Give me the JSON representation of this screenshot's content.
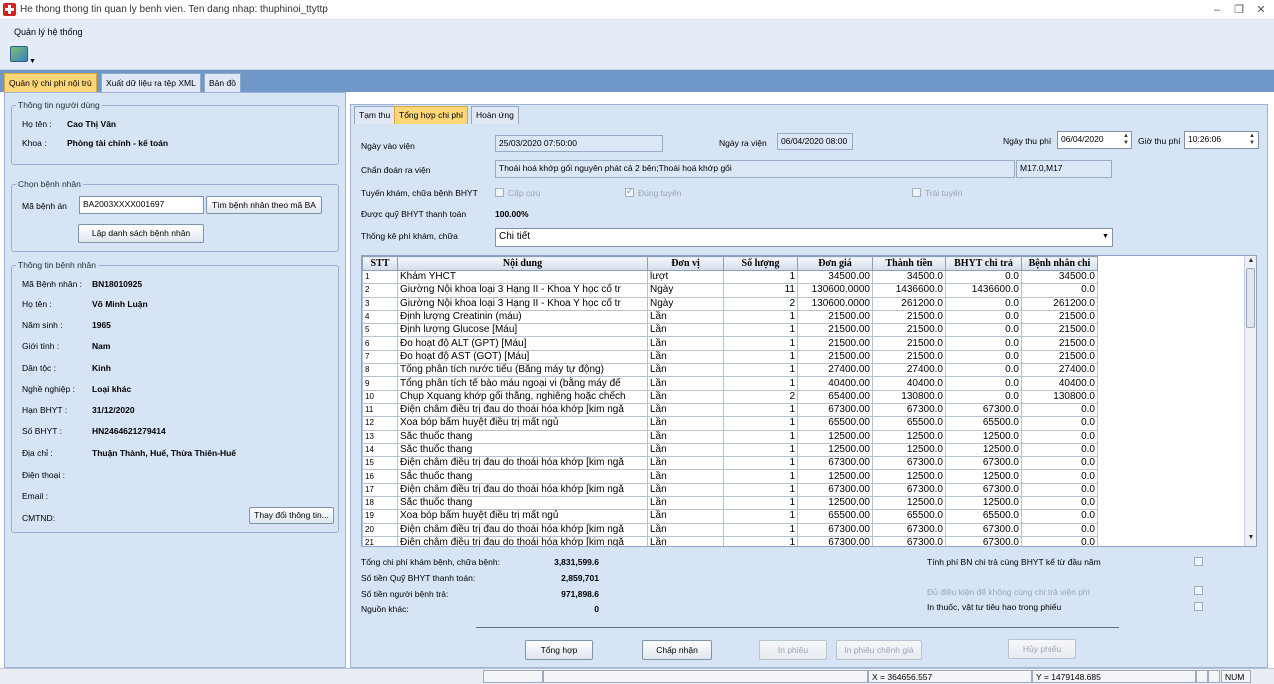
{
  "window": {
    "title": "He thong thong tin quan ly benh vien. Ten dang nhap: thuphinoi_ttyttp",
    "minimize": "–",
    "restore": "❐",
    "close": "✕"
  },
  "menu": {
    "system": "Quản lý hệ thống"
  },
  "toolbar": {
    "arrow": "▼"
  },
  "main_tabs": [
    "Quản lý chi phí nội trú",
    "Xuất dữ liệu ra tệp XML",
    "Bản đồ"
  ],
  "user_info": {
    "legend": "Thông tin người dùng",
    "name_label": "Họ tên :",
    "name": "Cao Thị Vân",
    "dept_label": "Khoa :",
    "dept": "Phòng tài chính - kế toán"
  },
  "select_patient": {
    "legend": "Chọn bệnh nhân",
    "record_label": "Mã bệnh án",
    "record_value": "BA2003XXXX001697",
    "search_button": "Tìm bệnh nhân theo mã BA",
    "list_button": "Lập danh sách bệnh nhân"
  },
  "patient_info": {
    "legend": "Thông tin bệnh nhân",
    "fields": [
      {
        "label": "Mã Bệnh nhân :",
        "value": "BN18010925"
      },
      {
        "label": "Họ tên :",
        "value": "Võ Minh Luận"
      },
      {
        "label": "Năm sinh :",
        "value": "1965"
      },
      {
        "label": "Giới tính :",
        "value": "Nam"
      },
      {
        "label": "Dân tộc :",
        "value": "Kinh"
      },
      {
        "label": "Nghề nghiệp :",
        "value": "Loại khác"
      },
      {
        "label": "Hạn BHYT :",
        "value": "31/12/2020"
      },
      {
        "label": "Số BHYT :",
        "value": "HN2464621279414"
      },
      {
        "label": "Địa chỉ :",
        "value": "Thuận Thành, Huế, Thừa Thiên-Huế"
      },
      {
        "label": "Điện thoại :",
        "value": ""
      },
      {
        "label": "Email :",
        "value": ""
      },
      {
        "label": "CMTND:",
        "value": ""
      }
    ],
    "change_button": "Thay đổi thông tin..."
  },
  "sub_tabs": [
    "Tạm thu",
    "Tổng hợp chi phí",
    "Hoàn ứng"
  ],
  "admission": {
    "admit_label": "Ngày vào viện",
    "admit_value": "25/03/2020 07:50:00",
    "discharge_label": "Ngày ra viện",
    "discharge_value": "06/04/2020 08:00",
    "fee_date_label": "Ngày thu phí",
    "fee_date_value": "06/04/2020",
    "fee_time_label": "Giờ thu phí",
    "fee_time_value": "10:26:06",
    "diagnosis_label": "Chẩn đoán ra viện",
    "diagnosis_value": "Thoái hoá khớp gối nguyên phát cả 2 bên;Thoái hoá khớp gối",
    "icd_value": "M17.0,M17",
    "route_label": "Tuyến khám, chữa bệnh BHYT",
    "emergency_label": "Cấp cứu",
    "correct_route_label": "Đúng tuyến",
    "wrong_route_label": "Trái tuyến",
    "fund_label": "Được quỹ BHYT thanh toán",
    "fund_value": "100.00%",
    "stats_label": "Thống kê phí khám, chữa",
    "stats_value": "Chi tiết"
  },
  "grid": {
    "columns": [
      "STT",
      "Nội dung",
      "Đơn vị",
      "Số lượng",
      "Đơn giá",
      "Thành tiền",
      "BHYT chi trả",
      "Bệnh nhân chi"
    ],
    "rows": [
      [
        "1",
        "Khám YHCT",
        "lượt",
        "1",
        "34500.00",
        "34500.0",
        "0.0",
        "34500.0"
      ],
      [
        "2",
        "Giường Nội khoa loại 3 Hạng II - Khoa Y học cổ tr",
        "Ngày",
        "11",
        "130600.0000",
        "1436600.0",
        "1436600.0",
        "0.0"
      ],
      [
        "3",
        "Giường Nội khoa loại 3 Hạng II - Khoa Y học cổ tr",
        "Ngày",
        "2",
        "130600.0000",
        "261200.0",
        "0.0",
        "261200.0"
      ],
      [
        "4",
        "Định lượng Creatinin (máu)",
        "Lần",
        "1",
        "21500.00",
        "21500.0",
        "0.0",
        "21500.0"
      ],
      [
        "5",
        "Định lượng Glucose [Máu]",
        "Lần",
        "1",
        "21500.00",
        "21500.0",
        "0.0",
        "21500.0"
      ],
      [
        "6",
        "Đo hoạt độ ALT (GPT) [Máu]",
        "Lần",
        "1",
        "21500.00",
        "21500.0",
        "0.0",
        "21500.0"
      ],
      [
        "7",
        "Đo hoạt độ AST (GOT) [Máu]",
        "Lần",
        "1",
        "21500.00",
        "21500.0",
        "0.0",
        "21500.0"
      ],
      [
        "8",
        "Tổng phân tích nước tiểu (Bằng máy tự động)",
        "Lần",
        "1",
        "27400.00",
        "27400.0",
        "0.0",
        "27400.0"
      ],
      [
        "9",
        "Tổng phân tích tế bào máu ngoại vi (bằng máy đế",
        "Lần",
        "1",
        "40400.00",
        "40400.0",
        "0.0",
        "40400.0"
      ],
      [
        "10",
        "Chụp Xquang khớp gối thẳng, nghiêng hoặc chếch",
        "Lần",
        "2",
        "65400.00",
        "130800.0",
        "0.0",
        "130800.0"
      ],
      [
        "11",
        "Điện châm điều trị đau do thoái hóa khớp [kim ngắ",
        "Lần",
        "1",
        "67300.00",
        "67300.0",
        "67300.0",
        "0.0"
      ],
      [
        "12",
        "Xoa bóp bấm huyệt điều trị mất ngủ",
        "Lần",
        "1",
        "65500.00",
        "65500.0",
        "65500.0",
        "0.0"
      ],
      [
        "13",
        "Sắc thuốc thang",
        "Lần",
        "1",
        "12500.00",
        "12500.0",
        "12500.0",
        "0.0"
      ],
      [
        "14",
        "Sắc thuốc thang",
        "Lần",
        "1",
        "12500.00",
        "12500.0",
        "12500.0",
        "0.0"
      ],
      [
        "15",
        "Điện châm điều trị đau do thoái hóa khớp [kim ngắ",
        "Lần",
        "1",
        "67300.00",
        "67300.0",
        "67300.0",
        "0.0"
      ],
      [
        "16",
        "Sắc thuốc thang",
        "Lần",
        "1",
        "12500.00",
        "12500.0",
        "12500.0",
        "0.0"
      ],
      [
        "17",
        "Điện châm điều trị đau do thoái hóa khớp [kim ngắ",
        "Lần",
        "1",
        "67300.00",
        "67300.0",
        "67300.0",
        "0.0"
      ],
      [
        "18",
        "Sắc thuốc thang",
        "Lần",
        "1",
        "12500.00",
        "12500.0",
        "12500.0",
        "0.0"
      ],
      [
        "19",
        "Xoa bóp bấm huyệt điều trị mất ngủ",
        "Lần",
        "1",
        "65500.00",
        "65500.0",
        "65500.0",
        "0.0"
      ],
      [
        "20",
        "Điện châm điều trị đau do thoái hóa khớp [kim ngắ",
        "Lần",
        "1",
        "67300.00",
        "67300.0",
        "67300.0",
        "0.0"
      ],
      [
        "21",
        "Điện châm điều trị đau do thoái hóa khớp [kim ngắ",
        "Lần",
        "1",
        "67300.00",
        "67300.0",
        "67300.0",
        "0.0"
      ]
    ]
  },
  "summary": {
    "total_label": "Tổng chi phí khám bệnh, chữa bệnh:",
    "total_value": "3,831,599.6",
    "fund_label": "Số tiền Quỹ BHYT thanh toán:",
    "fund_value": "2,859,701",
    "patient_label": "Số tiền người bệnh trả:",
    "patient_value": "971,898.6",
    "other_label": "Nguồn khác:",
    "other_value": "0",
    "opt1": "Tính phí BN chi trả cùng BHYT kể từ đầu năm",
    "opt2": "Đủ điều kiện để không cùng chi trả viện phí",
    "opt3": "In thuốc, vật tư tiêu hao trong phiếu"
  },
  "actions": {
    "aggregate": "Tổng hợp",
    "accept": "Chấp nhận",
    "print": "In phiếu",
    "print_diff": "In phiếu chênh giá",
    "cancel": "Hủy phiếu"
  },
  "status": {
    "x": "X = 364656.557",
    "y": "Y = 1479148.685",
    "num": "NUM"
  },
  "colors": {
    "active_tab": "#fbd77a",
    "panel": "#d7e4f6",
    "tabstrip": "#6f97c8"
  },
  "icons": [
    "hospital-cross-icon",
    "toolbar-tool-icon",
    "scroll-up-icon",
    "scroll-down-icon",
    "dropdown-arrow-icon",
    "spin-up-icon",
    "spin-down-icon"
  ]
}
